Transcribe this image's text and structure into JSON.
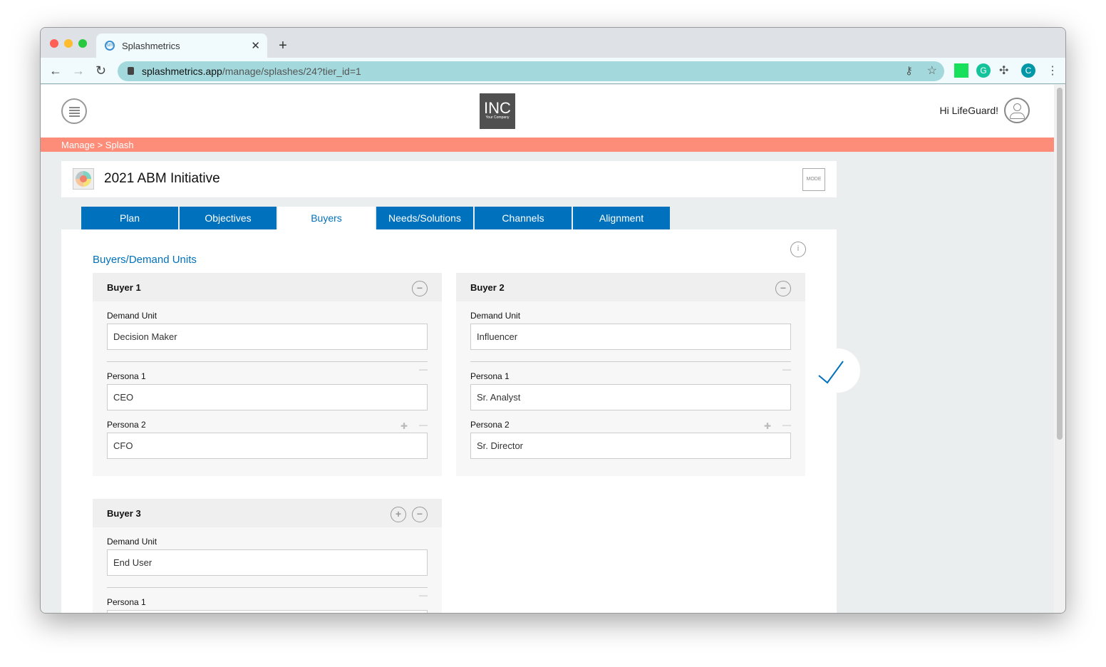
{
  "browser": {
    "tab_title": "Splashmetrics",
    "url_domain": "splashmetrics.app",
    "url_path": "/manage/splashes/24?tier_id=1",
    "profile_initial": "C"
  },
  "header": {
    "logo_main": "INC",
    "logo_sub": "Your Company",
    "greeting": "Hi LifeGuard!"
  },
  "breadcrumb": "Manage > Splash",
  "splash": {
    "title": "2021 ABM Initiative",
    "mode_label": "MODE"
  },
  "tabs": [
    {
      "label": "Plan"
    },
    {
      "label": "Objectives"
    },
    {
      "label": "Buyers",
      "active": true
    },
    {
      "label": "Needs/Solutions"
    },
    {
      "label": "Channels"
    },
    {
      "label": "Alignment"
    }
  ],
  "section_title": "Buyers/Demand Units",
  "buyers": [
    {
      "title": "Buyer 1",
      "demand_unit_label": "Demand Unit",
      "demand_unit": "Decision Maker",
      "personas": [
        {
          "label": "Persona 1",
          "value": "CEO"
        },
        {
          "label": "Persona 2",
          "value": "CFO"
        }
      ]
    },
    {
      "title": "Buyer 2",
      "demand_unit_label": "Demand Unit",
      "demand_unit": "Influencer",
      "personas": [
        {
          "label": "Persona 1",
          "value": "Sr. Analyst"
        },
        {
          "label": "Persona 2",
          "value": "Sr. Director"
        }
      ]
    },
    {
      "title": "Buyer 3",
      "demand_unit_label": "Demand Unit",
      "demand_unit": "End User",
      "personas": [
        {
          "label": "Persona 1",
          "value": ""
        }
      ]
    }
  ],
  "colors": {
    "brand_blue": "#0071bc",
    "breadcrumb_bg": "#fd8c78"
  }
}
